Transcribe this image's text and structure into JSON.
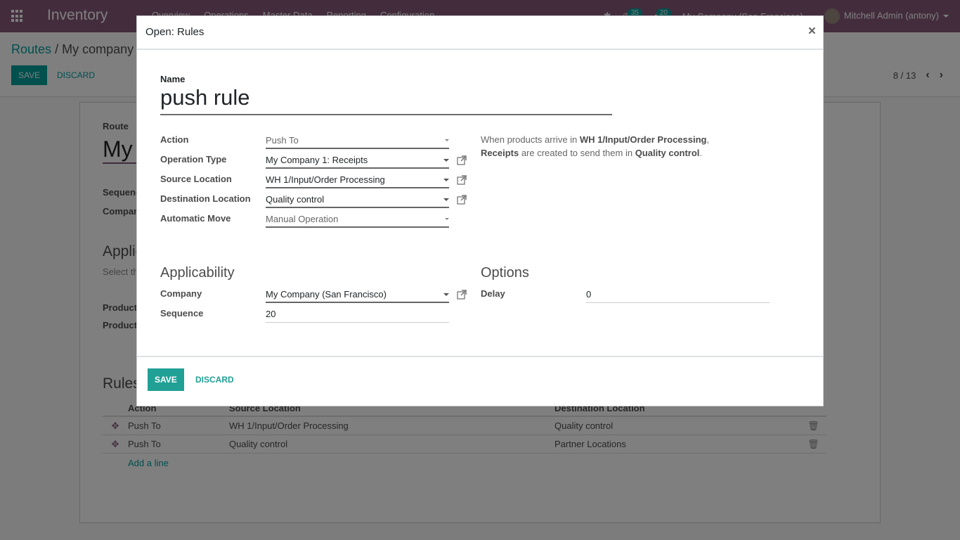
{
  "navbar": {
    "app_name": "Inventory",
    "menu": [
      "Overview",
      "Operations",
      "Master Data",
      "Reporting",
      "Configuration"
    ],
    "activity_count": "35",
    "message_count": "20",
    "company_switcher": "My Company (San Francisco)",
    "user": "Mitchell Admin (antony)"
  },
  "control_panel": {
    "breadcrumb_root": "Routes",
    "breadcrumb_separator": "/",
    "breadcrumb_current": "My company",
    "save_label": "SAVE",
    "discard_label": "DISCARD",
    "pager": "8 / 13"
  },
  "background_form": {
    "route_label": "Route",
    "route_name": "My",
    "sequence_label": "Sequence",
    "company_label": "Company",
    "applicability_title": "Applicability",
    "applicability_hint": "Select the",
    "product_categories_label": "Product",
    "products_label": "Products",
    "rules_title": "Rules",
    "rules_columns": [
      "Action",
      "Source Location",
      "Destination Location"
    ],
    "rules_rows": [
      {
        "action": "Push To",
        "source": "WH 1/Input/Order Processing",
        "destination": "Quality control"
      },
      {
        "action": "Push To",
        "source": "Quality control",
        "destination": "Partner Locations"
      }
    ],
    "add_line_label": "Add a line"
  },
  "modal": {
    "title": "Open: Rules",
    "close_icon": "×",
    "name_label": "Name",
    "name_value": "push rule",
    "fields": {
      "action": {
        "label": "Action",
        "value": "Push To"
      },
      "operation_type": {
        "label": "Operation Type",
        "value": "My Company 1: Receipts"
      },
      "source_location": {
        "label": "Source Location",
        "value": "WH 1/Input/Order Processing"
      },
      "destination_location": {
        "label": "Destination Location",
        "value": "Quality control"
      },
      "automatic_move": {
        "label": "Automatic Move",
        "value": "Manual Operation"
      }
    },
    "help": {
      "part1": "When products arrive in ",
      "source": "WH 1/Input/Order Processing",
      "part2": ",",
      "operation": "Receipts",
      "part3": " are created to send them in ",
      "destination": "Quality control",
      "part4": "."
    },
    "applicability": {
      "title": "Applicability",
      "company_label": "Company",
      "company_value": "My Company (San Francisco)",
      "sequence_label": "Sequence",
      "sequence_value": "20"
    },
    "options": {
      "title": "Options",
      "delay_label": "Delay",
      "delay_value": "0"
    },
    "footer": {
      "save_label": "SAVE",
      "discard_label": "DISCARD"
    }
  }
}
